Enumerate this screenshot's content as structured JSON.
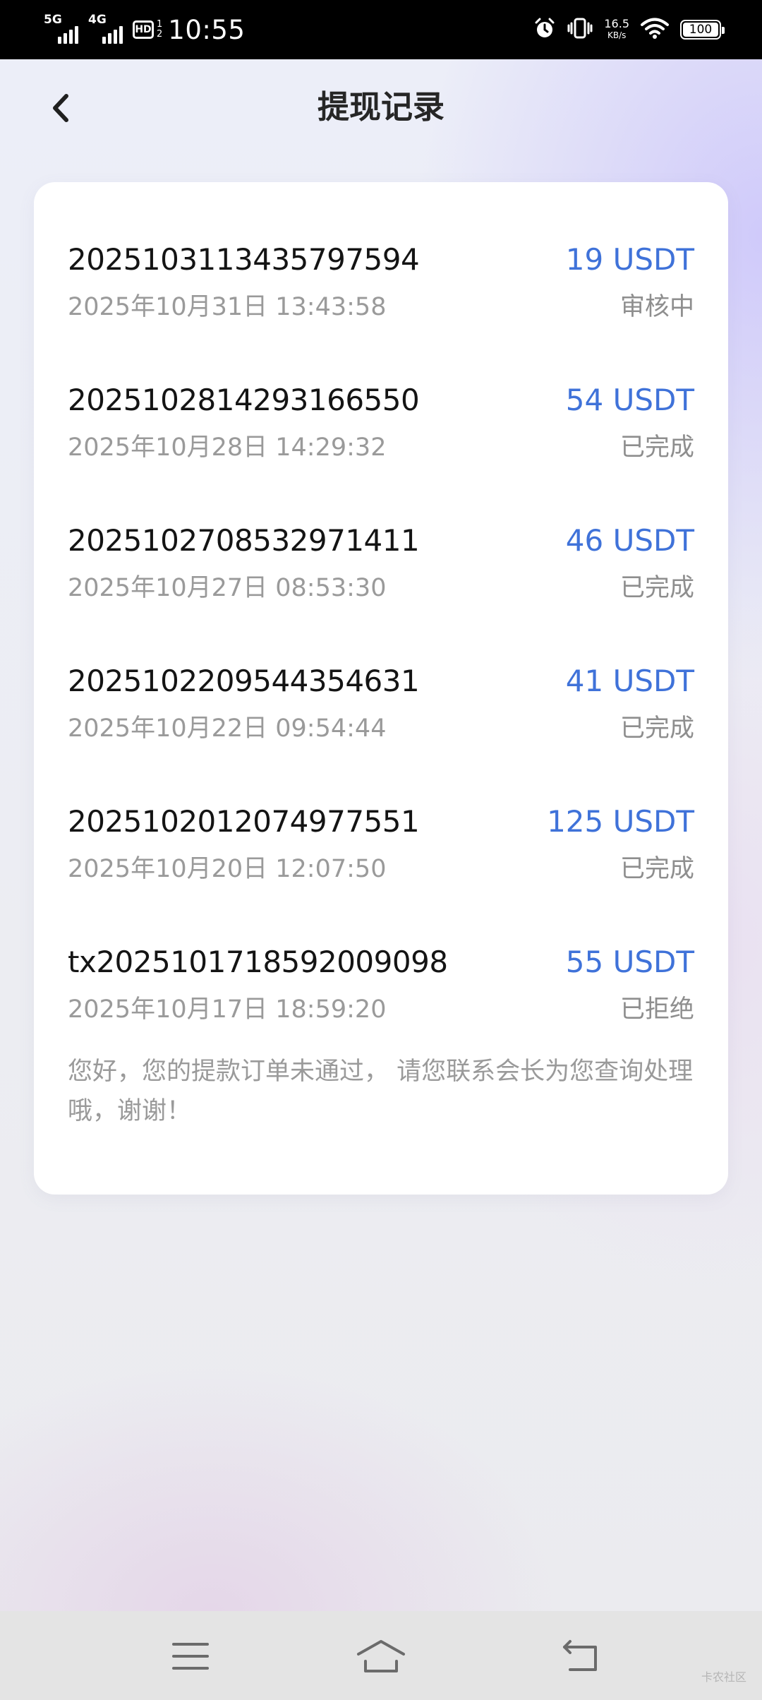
{
  "status_bar": {
    "network_1": "5G",
    "network_2": "4G",
    "hd_label": "HD",
    "hd_sub_top": "1",
    "hd_sub_bottom": "2",
    "time": "10:55",
    "net_speed_value": "16.5",
    "net_speed_unit": "KB/s",
    "battery_level": "100"
  },
  "header": {
    "title": "提现记录"
  },
  "records": [
    {
      "id": "20251031134357975​94",
      "amount": "19 USDT",
      "time": "2025年10月31日 13:43:58",
      "status": "审核中"
    },
    {
      "id": "20251028142931665​50",
      "amount": "54 USDT",
      "time": "2025年10月28日 14:29:32",
      "status": "已完成"
    },
    {
      "id": "20251027085329714​11",
      "amount": "46 USDT",
      "time": "2025年10月27日 08:53:30",
      "status": "已完成"
    },
    {
      "id": "20251022095443546​31",
      "amount": "41 USDT",
      "time": "2025年10月22日 09:54:44",
      "status": "已完成"
    },
    {
      "id": "20251020120749775​51",
      "amount": "125 USDT",
      "time": "2025年10月20日 12:07:50",
      "status": "已完成"
    },
    {
      "id": "tx20251017185920090​98",
      "amount": "55 USDT",
      "time": "2025年10月17日 18:59:20",
      "status": "已拒绝",
      "note": "您好，您的提款订单未通过， 请您联系会长为您查询处理哦，谢谢！"
    }
  ],
  "watermark": "卡农社区",
  "colors": {
    "accent_amount": "#3f72d9",
    "title_text": "#262626",
    "secondary_text": "#9a9a9a"
  },
  "icons": {
    "back": "chevron-left-icon",
    "nav_menu": "menu-icon",
    "nav_home": "home-icon",
    "nav_back": "return-icon",
    "alarm": "alarm-icon",
    "vibrate": "vibrate-icon",
    "wifi": "wifi-icon"
  }
}
